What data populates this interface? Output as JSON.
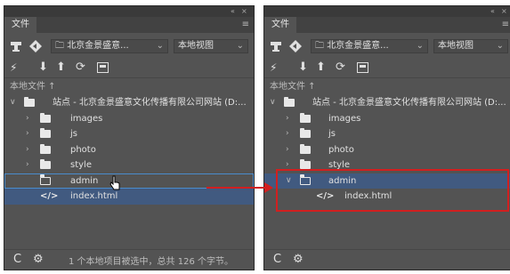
{
  "panel": {
    "tab_label": "文件",
    "collapse_glyph": "«",
    "close_glyph": "×",
    "menu_glyph": "≡",
    "site_select_value": "北京金景盛意...",
    "view_select_value": "本地视图",
    "path_label": "本地文件 ↑",
    "site_row_label": "站点 - 北京金景盛意文化传播有限公司网站 (D:...",
    "status_text": "1 个本地项目被选中，总共 126 个字节。"
  },
  "left_tree": [
    {
      "label": "images"
    },
    {
      "label": "js"
    },
    {
      "label": "photo"
    },
    {
      "label": "style"
    },
    {
      "label": "admin"
    },
    {
      "label": "index.html"
    }
  ],
  "right_tree": [
    {
      "label": "images"
    },
    {
      "label": "js"
    },
    {
      "label": "photo"
    },
    {
      "label": "style"
    },
    {
      "label": "admin"
    },
    {
      "label": "index.html"
    }
  ],
  "icons": {
    "connect": "plug-icon",
    "sync": "arrows-icon",
    "site": "folder-icon",
    "disconnect": "disconnect-icon",
    "get": "down-arrow-icon",
    "put": "up-arrow-icon",
    "refresh": "refresh-icon",
    "expand": "expand-icon",
    "check": "c-icon",
    "settings": "gear-icon"
  },
  "colors": {
    "panel_bg": "#535353",
    "selection": "#415a80",
    "highlight": "#d21f1f"
  }
}
